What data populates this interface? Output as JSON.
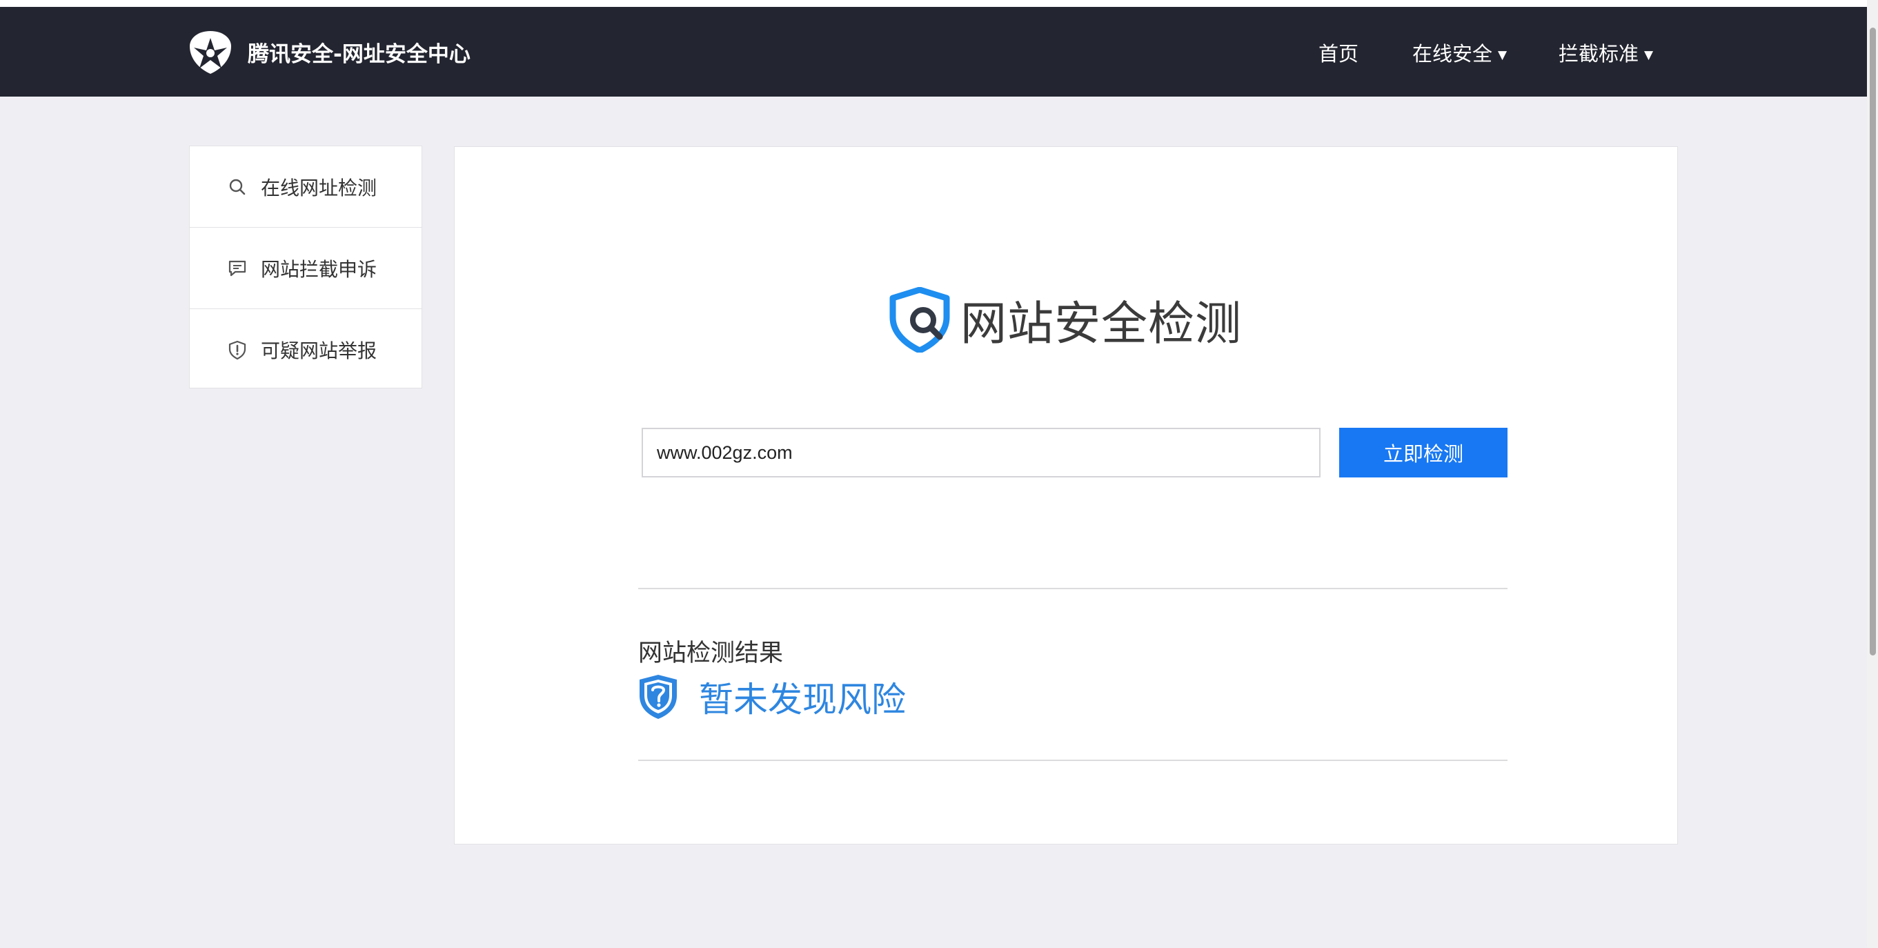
{
  "header": {
    "brand_title": "腾讯安全-网址安全中心",
    "nav": [
      {
        "label": "首页",
        "has_dropdown": false
      },
      {
        "label": "在线安全",
        "has_dropdown": true
      },
      {
        "label": "拦截标准",
        "has_dropdown": true
      }
    ],
    "background_color": "#232530"
  },
  "sidebar": {
    "items": [
      {
        "label": "在线网址检测",
        "icon": "search-icon"
      },
      {
        "label": "网站拦截申诉",
        "icon": "message-icon"
      },
      {
        "label": "可疑网站举报",
        "icon": "shield-alert-icon"
      }
    ]
  },
  "main": {
    "hero_title": "网站安全检测",
    "url_input": {
      "value": "www.002gz.com"
    },
    "check_button_label": "立即检测",
    "result": {
      "heading": "网站检测结果",
      "status": "暂未发现风险",
      "status_icon": "shield-question-icon"
    }
  },
  "colors": {
    "accent": "#1878f3",
    "result_text": "#2e86e0",
    "page_background": "#efeff3"
  }
}
